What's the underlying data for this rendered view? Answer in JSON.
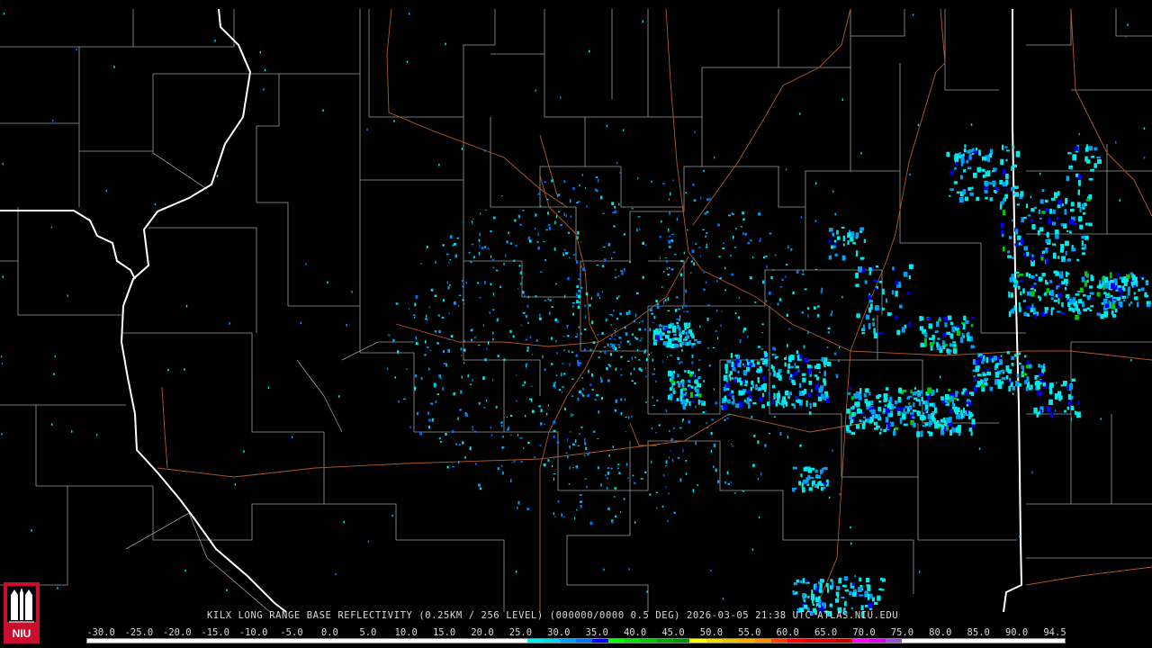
{
  "product_caption": "KILX LONG RANGE BASE REFLECTIVITY (0.25KM / 256 LEVEL) (000000/0000 0.5 DEG) 2026-03-05 21:38 UTC  ATLAS.NIU.EDU",
  "logo_text": "NIU",
  "scale": {
    "labels": [
      "-30.0",
      "-25.0",
      "-20.0",
      "-15.0",
      "-10.0",
      "-5.0",
      "0.0",
      "5.0",
      "10.0",
      "15.0",
      "20.0",
      "25.0",
      "30.0",
      "35.0",
      "40.0",
      "45.0",
      "50.0",
      "55.0",
      "60.0",
      "65.0",
      "70.0",
      "75.0",
      "80.0",
      "85.0",
      "90.0",
      "94.5"
    ],
    "colors": [
      "#ffffff",
      "#ffffff",
      "#ffffff",
      "#ffffff",
      "#ffffff",
      "#ffffff",
      "#00ecec",
      "#01a0f6",
      "#0000f6",
      "#00ff00",
      "#00c800",
      "#009000",
      "#ffff00",
      "#e7c000",
      "#ff9000",
      "#ff0000",
      "#d60000",
      "#c00000",
      "#ff00ff",
      "#9955c9",
      "#ffffff",
      "#ffffff",
      "#ffffff",
      "#ffffff",
      "#ffffff"
    ]
  },
  "colors": {
    "state_border": "#ffffff",
    "county_border": "#9a9a9a",
    "roads": "#b05a28",
    "background": "#000000"
  }
}
